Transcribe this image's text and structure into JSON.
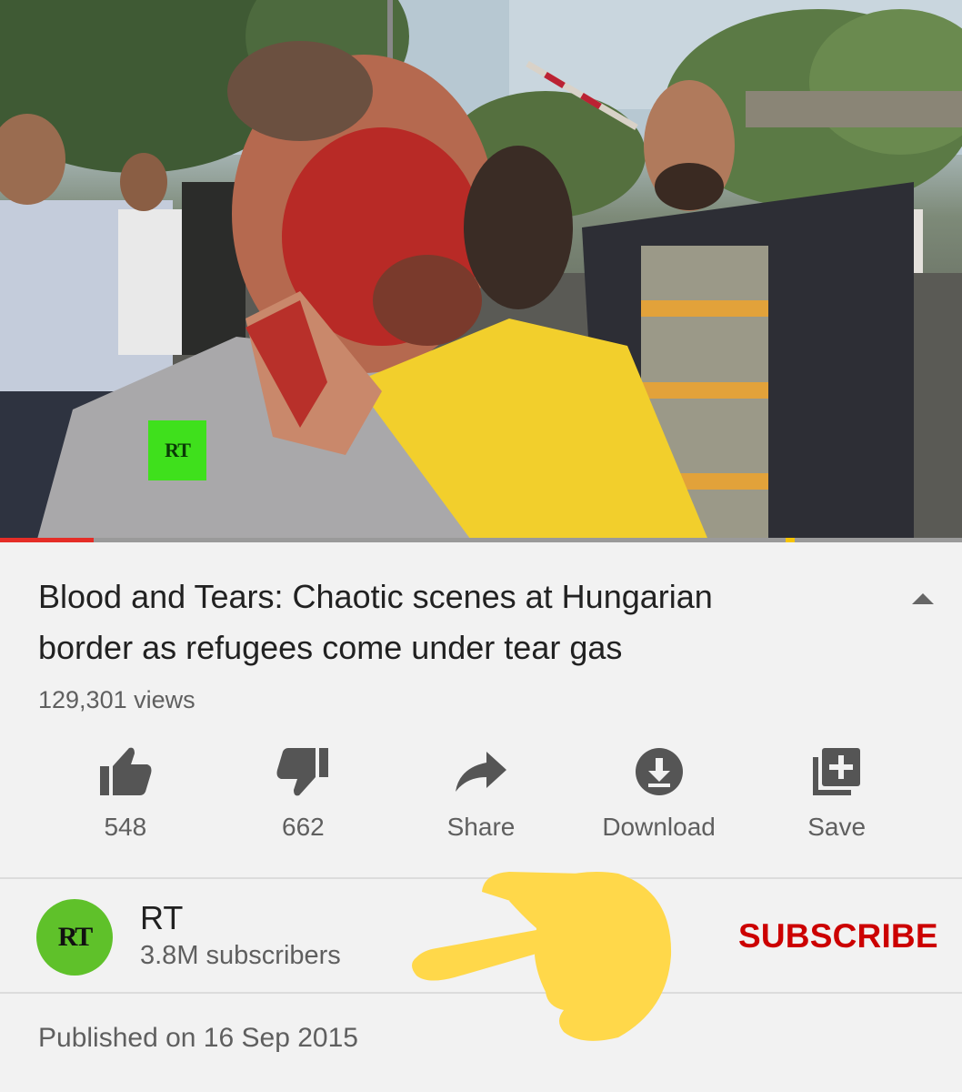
{
  "video": {
    "watermark": "RT",
    "progress_fraction": 0.097,
    "colors": {
      "progress": "#e52d27",
      "buffer": "#f7c400",
      "watermark_bg": "#3fe01c"
    }
  },
  "info": {
    "title_line1": "Blood and Tears: Chaotic scenes at Hungarian",
    "title_line2": "border as refugees come under tear gas",
    "views": "129,301 views",
    "collapse_icon": "chevron-up-icon"
  },
  "actions": [
    {
      "icon": "thumbs-up-icon",
      "label": "548"
    },
    {
      "icon": "thumbs-down-icon",
      "label": "662"
    },
    {
      "icon": "share-icon",
      "label": "Share"
    },
    {
      "icon": "download-icon",
      "label": "Download"
    },
    {
      "icon": "add-to-playlist-icon",
      "label": "Save"
    }
  ],
  "channel": {
    "avatar_text": "RT",
    "name": "RT",
    "subscribers": "3.8M subscribers",
    "subscribe_label": "SUBSCRIBE",
    "colors": {
      "subscribe": "#cc0000",
      "avatar_bg": "#5fc12a"
    }
  },
  "published": "Published on 16 Sep 2015",
  "annotation": {
    "icon": "pointing-hand-icon",
    "color": "#ffd84a"
  }
}
